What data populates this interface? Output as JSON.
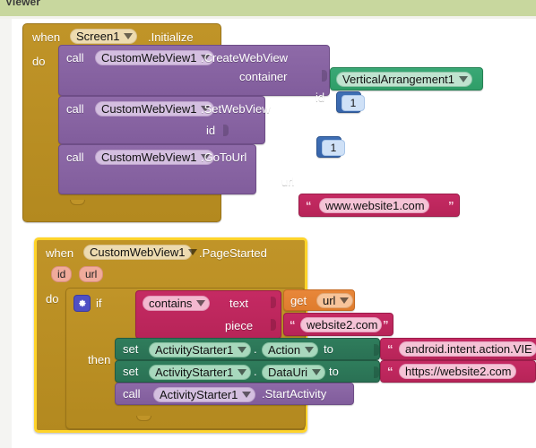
{
  "panel": {
    "title": "Viewer"
  },
  "colors": {
    "header_bg": "#c8d79e",
    "event_block": "#b8860b",
    "call_block": "#8e6aa8",
    "setter_block": "#2f7d5c",
    "text_block": "#c52a63",
    "variable_block": "#e8873a",
    "number_block": "#3f6fb5",
    "component_block": "#2f9e68",
    "selection_outline": "#ffd42a"
  },
  "blocks": {
    "screen_init": {
      "when_label": "when",
      "component": "Screen1",
      "event": ".Initialize",
      "do_label": "do",
      "statements": [
        {
          "call_label": "call",
          "component": "CustomWebView1",
          "method": ".CreateWebView",
          "args": [
            {
              "name": "container",
              "value": "VerticalArrangement1",
              "kind": "component-dropdown"
            },
            {
              "name": "id",
              "value": "1",
              "kind": "number"
            }
          ]
        },
        {
          "call_label": "call",
          "component": "CustomWebView1",
          "method": ".SetWebView",
          "args": [
            {
              "name": "id",
              "value": "1",
              "kind": "number"
            }
          ]
        },
        {
          "call_label": "call",
          "component": "CustomWebView1",
          "method": ".GoToUrl",
          "args": [
            {
              "name": "url",
              "value": "www.website1.com",
              "kind": "text"
            }
          ]
        }
      ]
    },
    "page_started": {
      "selected": true,
      "when_label": "when",
      "component": "CustomWebView1",
      "event": ".PageStarted",
      "params": [
        "id",
        "url"
      ],
      "do_label": "do",
      "if_label": "if",
      "then_label": "then",
      "condition": {
        "operator": "contains",
        "text_label": "text",
        "text_value": {
          "kind": "variable-get",
          "get_label": "get",
          "name": "url"
        },
        "piece_label": "piece",
        "piece_value": {
          "kind": "text",
          "value": "website2.com"
        }
      },
      "then_statements": [
        {
          "kind": "setter",
          "set_label": "set",
          "component": "ActivityStarter1",
          "dot": ".",
          "property": "Action",
          "to_label": "to",
          "value": {
            "kind": "text",
            "value": "android.intent.action.VIE"
          }
        },
        {
          "kind": "setter",
          "set_label": "set",
          "component": "ActivityStarter1",
          "dot": ".",
          "property": "DataUri",
          "to_label": "to",
          "value": {
            "kind": "text",
            "value": "https://website2.com"
          }
        },
        {
          "kind": "call",
          "call_label": "call",
          "component": "ActivityStarter1",
          "method": ".StartActivity"
        }
      ]
    }
  },
  "icons": {
    "mutator": "gear-icon",
    "dropdown": "chevron-down-icon"
  }
}
